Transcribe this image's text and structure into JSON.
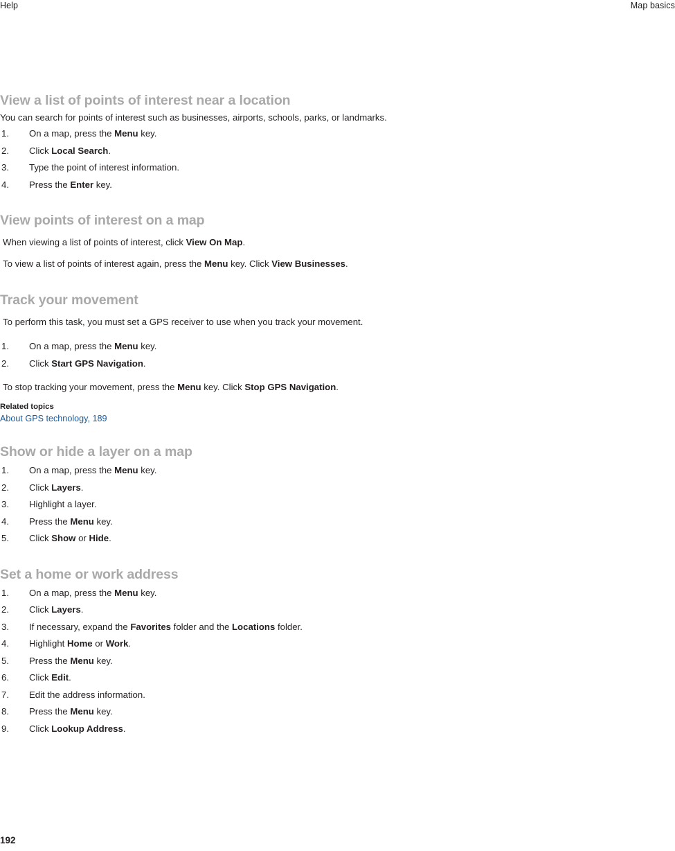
{
  "running_head": {
    "left": "Help",
    "right": "Map basics"
  },
  "sections": [
    {
      "heading": "View a list of points of interest near a location",
      "intro": "You can search for points of interest such as businesses, airports, schools, parks, or landmarks.",
      "steps": [
        {
          "pre": "On a map, press the ",
          "bold": "Menu",
          "post": " key."
        },
        {
          "pre": "Click ",
          "bold": "Local Search",
          "post": "."
        },
        {
          "pre": "Type the point of interest information.",
          "bold": "",
          "post": ""
        },
        {
          "pre": "Press the ",
          "bold": "Enter",
          "post": " key."
        }
      ]
    },
    {
      "heading": "View points of interest on a map",
      "paragraphs": [
        {
          "pre": "When viewing a list of points of interest, click ",
          "bold": "View On Map",
          "post": "."
        },
        {
          "pre": "To view a list of points of interest again, press the ",
          "bold": "Menu",
          "mid": " key. Click ",
          "bold2": "View Businesses",
          "post": "."
        }
      ]
    },
    {
      "heading": "Track your movement",
      "intro": "To perform this task, you must set a GPS receiver to use when you track your movement.",
      "steps": [
        {
          "pre": "On a map, press the ",
          "bold": "Menu",
          "post": " key."
        },
        {
          "pre": "Click ",
          "bold": "Start GPS Navigation",
          "post": "."
        }
      ],
      "closing": {
        "pre": "To stop tracking your movement, press the ",
        "bold": "Menu",
        "mid": " key. Click ",
        "bold2": "Stop GPS Navigation",
        "post": "."
      },
      "related": {
        "title": "Related topics",
        "link": "About GPS technology, 189"
      }
    },
    {
      "heading": "Show or hide a layer on a map",
      "steps": [
        {
          "pre": "On a map, press the ",
          "bold": "Menu",
          "post": " key."
        },
        {
          "pre": "Click ",
          "bold": "Layers",
          "post": "."
        },
        {
          "pre": "Highlight a layer.",
          "bold": "",
          "post": ""
        },
        {
          "pre": "Press the ",
          "bold": "Menu",
          "post": " key."
        },
        {
          "pre": "Click ",
          "bold": "Show",
          "mid": " or ",
          "bold2": "Hide",
          "post": "."
        }
      ]
    },
    {
      "heading": "Set a home or work address",
      "steps": [
        {
          "pre": "On a map, press the ",
          "bold": "Menu",
          "post": " key."
        },
        {
          "pre": "Click ",
          "bold": "Layers",
          "post": "."
        },
        {
          "pre": "If necessary, expand the ",
          "bold": "Favorites",
          "mid": " folder and the ",
          "bold2": "Locations",
          "post": " folder."
        },
        {
          "pre": "Highlight ",
          "bold": "Home",
          "mid": " or ",
          "bold2": "Work",
          "post": "."
        },
        {
          "pre": "Press the ",
          "bold": "Menu",
          "post": " key."
        },
        {
          "pre": "Click ",
          "bold": "Edit",
          "post": "."
        },
        {
          "pre": "Edit the address information.",
          "bold": "",
          "post": ""
        },
        {
          "pre": "Press the ",
          "bold": "Menu",
          "post": " key."
        },
        {
          "pre": "Click ",
          "bold": "Lookup Address",
          "post": "."
        }
      ]
    }
  ],
  "footer": {
    "page_number": "192"
  },
  "colors": {
    "heading_gray": "#a9a9a9",
    "link_blue": "#16599d",
    "text_black": "#231f20"
  }
}
